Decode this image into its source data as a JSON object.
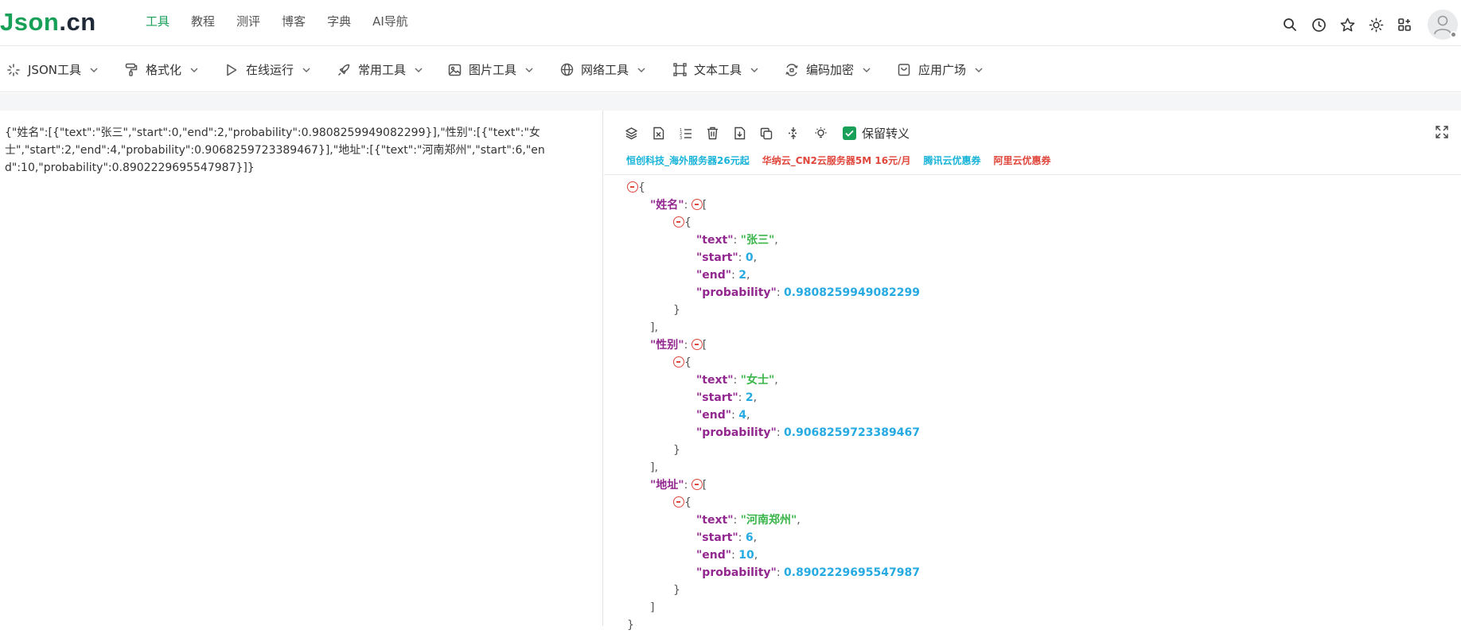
{
  "brand": {
    "logo_main": "Json",
    "logo_dot": ".cn"
  },
  "top_nav": [
    "工具",
    "教程",
    "测评",
    "博客",
    "字典",
    "AI导航"
  ],
  "top_nav_active": "工具",
  "top_icons": [
    "search-icon",
    "history-icon",
    "star-icon",
    "theme-icon",
    "apps-icon",
    "user-avatar"
  ],
  "menu": [
    {
      "label": "JSON工具",
      "icon": "sparkle-icon"
    },
    {
      "label": "格式化",
      "icon": "paint-roller-icon"
    },
    {
      "label": "在线运行",
      "icon": "play-icon"
    },
    {
      "label": "常用工具",
      "icon": "rocket-icon"
    },
    {
      "label": "图片工具",
      "icon": "image-icon"
    },
    {
      "label": "网络工具",
      "icon": "globe-icon"
    },
    {
      "label": "文本工具",
      "icon": "text-frame-icon"
    },
    {
      "label": "编码加密",
      "icon": "encode-icon"
    },
    {
      "label": "应用广场",
      "icon": "bag-icon"
    }
  ],
  "editor": {
    "raw_text": "{\"姓名\":[{\"text\":\"张三\",\"start\":0,\"end\":2,\"probability\":0.9808259949082299}],\"性别\":[{\"text\":\"女士\",\"start\":2,\"end\":4,\"probability\":0.9068259723389467}],\"地址\":[{\"text\":\"河南郑州\",\"start\":6,\"end\":10,\"probability\":0.8902229695547987}]}"
  },
  "viewer": {
    "keep_escape_label": "保留转义",
    "keep_escape_checked": true,
    "ads": [
      {
        "text": "恒创科技_海外服务器26元起",
        "color": "#17b3d9"
      },
      {
        "text": "华纳云_CN2云服务器5M 16元/月",
        "color": "#e0463b"
      },
      {
        "text": "腾讯云优惠券",
        "color": "#17b3d9"
      },
      {
        "text": "阿里云优惠券",
        "color": "#e0463b"
      }
    ],
    "json": {
      "姓名": [
        {
          "text": "张三",
          "start": 0,
          "end": 2,
          "probability": "0.9808259949082299"
        }
      ],
      "性别": [
        {
          "text": "女士",
          "start": 2,
          "end": 4,
          "probability": "0.9068259723389467"
        }
      ],
      "地址": [
        {
          "text": "河南郑州",
          "start": 6,
          "end": 10,
          "probability": "0.8902229695547987"
        }
      ]
    }
  },
  "colors": {
    "accent": "#18a058",
    "key": "#92278f",
    "string": "#3ab54a",
    "number": "#25aae2",
    "collapse": "#e0463b"
  }
}
